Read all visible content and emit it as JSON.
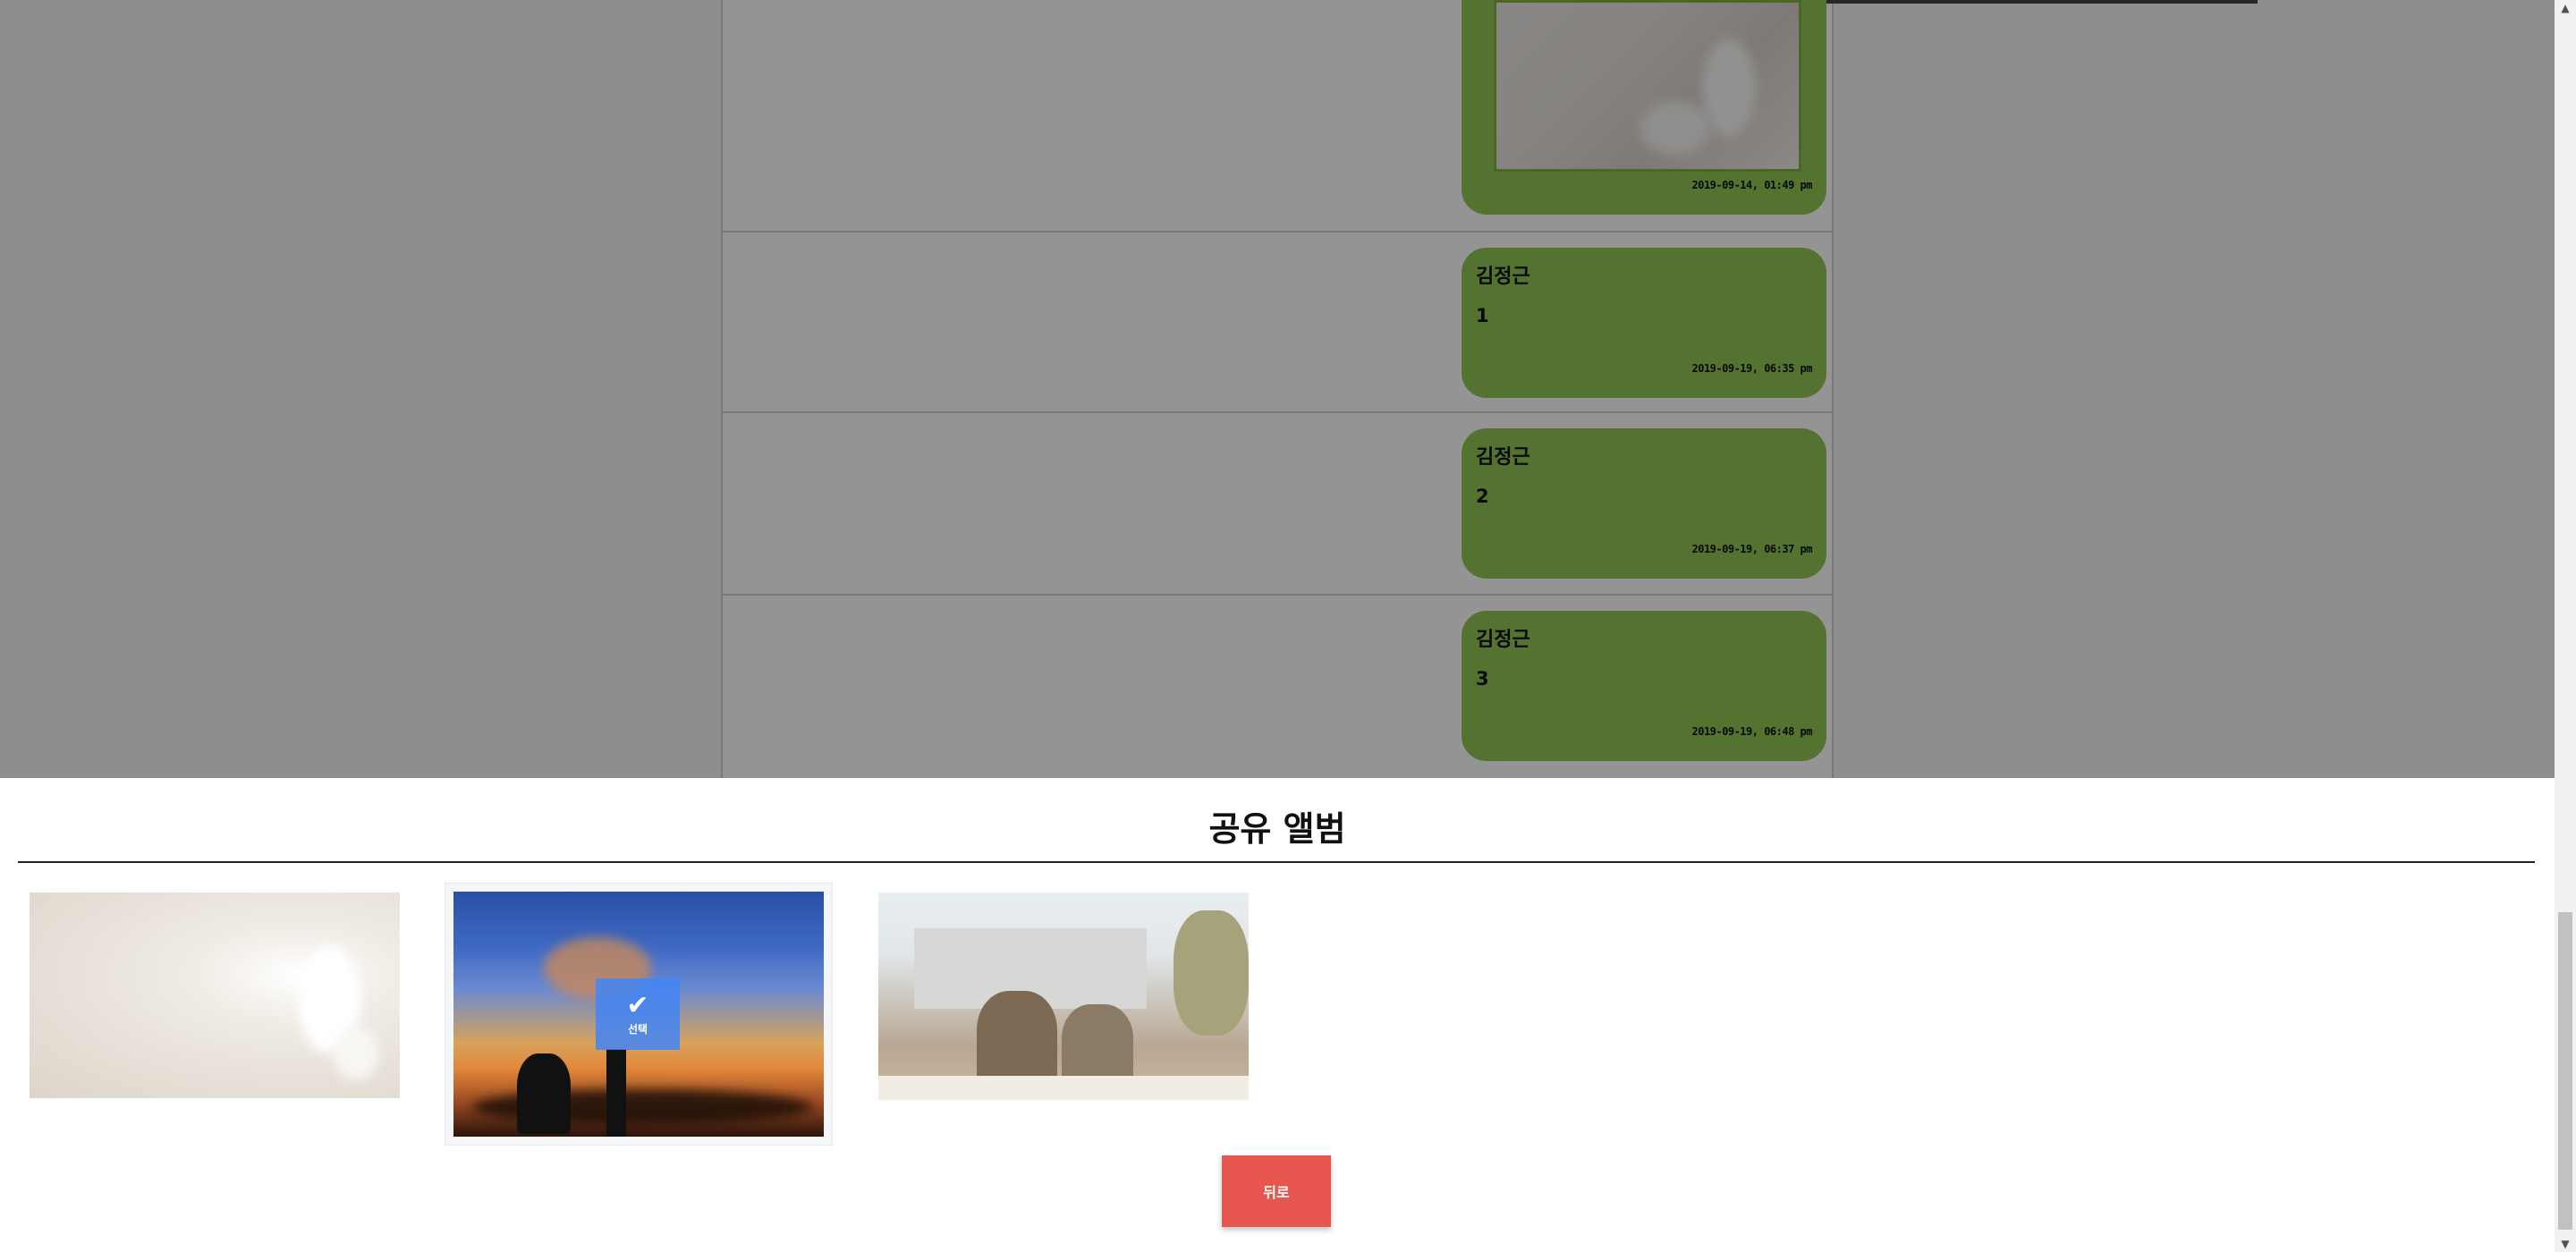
{
  "chat": {
    "messages": [
      {
        "time": "2019-09-14, 01:49 pm"
      },
      {
        "sender": "김정근",
        "text": "1",
        "time": "2019-09-19, 06:35 pm"
      },
      {
        "sender": "김정근",
        "text": "2",
        "time": "2019-09-19, 06:37 pm"
      },
      {
        "sender": "김정근",
        "text": "3",
        "time": "2019-09-19, 06:48 pm"
      }
    ]
  },
  "album": {
    "title": "공유 앨범",
    "photos": [
      {
        "name": "bokeh-photo",
        "selected": false
      },
      {
        "name": "wedding-sunset-photo",
        "selected": true
      },
      {
        "name": "couple-on-bench-photo",
        "selected": false
      }
    ],
    "select_badge_label": "선택",
    "back_button_label": "뒤로"
  },
  "colors": {
    "bubble": "#92c454",
    "back_button": "#e8574f",
    "select_badge": "#4285f4"
  }
}
